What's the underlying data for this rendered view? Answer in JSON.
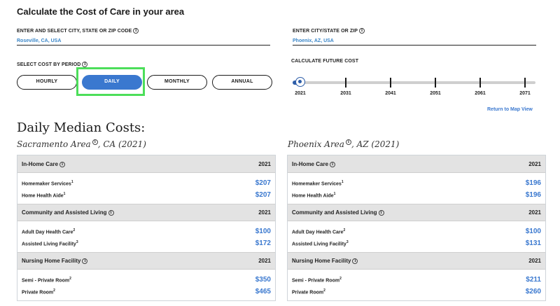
{
  "title": "Calculate the Cost of Care in your area",
  "city1": {
    "label": "ENTER AND SELECT CITY, STATE OR ZIP CODE",
    "value": "Roseville, CA, USA"
  },
  "city2": {
    "label": "ENTER CITY/STATE OR ZIP",
    "value": "Phoenix, AZ, USA"
  },
  "period": {
    "label": "SELECT COST BY PERIOD",
    "options": [
      "HOURLY",
      "DAILY",
      "MONTHLY",
      "ANNUAL"
    ],
    "selected": "DAILY"
  },
  "future": {
    "label": "CALCULATE FUTURE COST",
    "ticks": [
      "2021",
      "2031",
      "2041",
      "2051",
      "2061",
      "2071"
    ],
    "selected_year": "2021"
  },
  "return_link": "Return to Map View",
  "heading": "Daily Median Costs:",
  "left": {
    "area_name": "Sacramento Area",
    "area_suffix": ", CA (2021)",
    "sections": [
      {
        "title": "In-Home Care",
        "year": "2021",
        "rows": [
          {
            "label": "Homemaker Services",
            "sup": "1",
            "value": "$207"
          },
          {
            "label": "Home Health Aide",
            "sup": "1",
            "value": "$207"
          }
        ]
      },
      {
        "title": "Community and Assisted Living",
        "year": "2021",
        "rows": [
          {
            "label": "Adult Day Health Care",
            "sup": "2",
            "value": "$100"
          },
          {
            "label": "Assisted Living Facility",
            "sup": "3",
            "value": "$172"
          }
        ]
      },
      {
        "title": "Nursing Home Facility",
        "year": "2021",
        "rows": [
          {
            "label": "Semi - Private Room",
            "sup": "2",
            "value": "$350"
          },
          {
            "label": "Private Room",
            "sup": "2",
            "value": "$465"
          }
        ]
      }
    ]
  },
  "right": {
    "area_name": "Phoenix Area",
    "area_suffix": ", AZ (2021)",
    "sections": [
      {
        "title": "In-Home Care",
        "year": "2021",
        "rows": [
          {
            "label": "Homemaker Services",
            "sup": "1",
            "value": "$196"
          },
          {
            "label": "Home Health Aide",
            "sup": "1",
            "value": "$196"
          }
        ]
      },
      {
        "title": "Community and Assisted Living",
        "year": "2021",
        "rows": [
          {
            "label": "Adult Day Health Care",
            "sup": "2",
            "value": "$100"
          },
          {
            "label": "Assisted Living Facility",
            "sup": "3",
            "value": "$131"
          }
        ]
      },
      {
        "title": "Nursing Home Facility",
        "year": "2021",
        "rows": [
          {
            "label": "Semi - Private Room",
            "sup": "2",
            "value": "$211"
          },
          {
            "label": "Private Room",
            "sup": "2",
            "value": "$260"
          }
        ]
      }
    ]
  },
  "colors": {
    "accent": "#3a78cf",
    "highlight": "#4cde5a",
    "header_bg": "#e3e3e3"
  }
}
